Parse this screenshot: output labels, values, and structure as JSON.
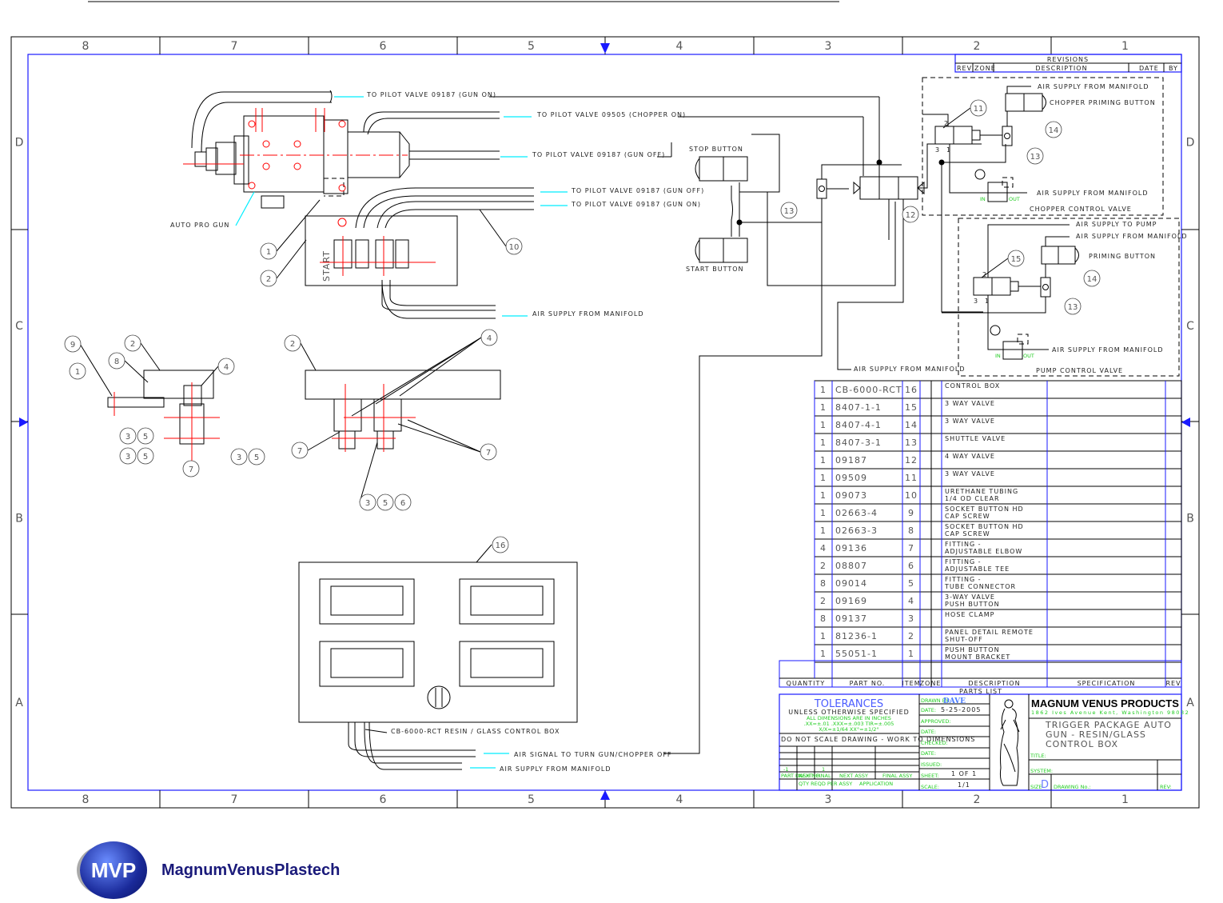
{
  "frame": {
    "zones_top": [
      "8",
      "7",
      "6",
      "5",
      "4",
      "3",
      "2",
      "1"
    ],
    "zones_side": [
      "D",
      "C",
      "B",
      "A"
    ],
    "colors": {
      "border": "#1a1aff",
      "centerline": "#ff0000",
      "leader": "#00e5ff",
      "note": "#22cc22"
    }
  },
  "labels": {
    "gun_on_1": "TO PILOT VALVE 09187 (GUN ON)",
    "chopper_on": "TO PILOT VALVE 09505 (CHOPPER ON)",
    "gun_off_1": "TO PILOT VALVE 09187 (GUN OFF)",
    "gun_off_2": "TO PILOT VALVE 09187 (GUN OFF)",
    "gun_on_2": "TO PILOT VALVE 09187 (GUN ON)",
    "air_supply_1": "AIR SUPPLY FROM MANIFOLD",
    "auto_pro_gun": "AUTO PRO GUN",
    "start_panel": "START",
    "stop_button": "STOP BUTTON",
    "start_button": "START BUTTON",
    "air_supply_center": "AIR SUPPLY FROM MANIFOLD",
    "control_box": "CB-6000-RCT RESIN / GLASS CONTROL BOX",
    "air_signal_off": "AIR SIGNAL TO TURN GUN/CHOPPER OFF",
    "air_supply_box": "AIR SUPPLY FROM MANIFOLD"
  },
  "chopper_group": {
    "air_supply_top": "AIR SUPPLY FROM MANIFOLD",
    "priming_button": "CHOPPER PRIMING BUTTON",
    "air_supply_bottom": "AIR SUPPLY FROM MANIFOLD",
    "title": "CHOPPER CONTROL VALVE",
    "in": "IN",
    "out": "OUT",
    "port_2": "2",
    "port_3": "3",
    "port_1": "1"
  },
  "pump_group": {
    "air_to_pump": "AIR SUPPLY TO PUMP",
    "air_supply_top": "AIR SUPPLY FROM MANIFOLD",
    "priming_button": "PRIMING BUTTON",
    "air_supply_bottom": "AIR SUPPLY FROM MANIFOLD",
    "title": "PUMP CONTROL VALVE",
    "in": "IN",
    "out": "OUT",
    "port_2": "2",
    "port_3": "3",
    "port_1": "1"
  },
  "balloons": [
    "11",
    "14",
    "13",
    "13",
    "12",
    "15",
    "14",
    "13",
    "1",
    "2",
    "10",
    "9",
    "8",
    "1",
    "2",
    "4",
    "3",
    "5",
    "3",
    "5",
    "3",
    "5",
    "7",
    "2",
    "4",
    "7",
    "7",
    "3",
    "5",
    "6",
    "16"
  ],
  "revisions": {
    "title": "REVISIONS",
    "headers": [
      "REV",
      "ZONE",
      "DESCRIPTION",
      "DATE",
      "BY"
    ]
  },
  "parts_list": {
    "title": "PARTS LIST",
    "headers": [
      "QUANTITY",
      "PART NO.",
      "ITEM",
      "ZONE",
      "DESCRIPTION",
      "SPECIFICATION",
      "REV"
    ],
    "rows": [
      {
        "qty": "1",
        "part": "CB-6000-RCT",
        "item": "16",
        "desc": [
          "CONTROL BOX"
        ]
      },
      {
        "qty": "1",
        "part": "8407-1-1",
        "item": "15",
        "desc": [
          "3 WAY VALVE"
        ]
      },
      {
        "qty": "1",
        "part": "8407-4-1",
        "item": "14",
        "desc": [
          "3 WAY VALVE"
        ]
      },
      {
        "qty": "1",
        "part": "8407-3-1",
        "item": "13",
        "desc": [
          "SHUTTLE VALVE"
        ]
      },
      {
        "qty": "1",
        "part": "09187",
        "item": "12",
        "desc": [
          "4 WAY VALVE"
        ]
      },
      {
        "qty": "1",
        "part": "09509",
        "item": "11",
        "desc": [
          "3 WAY VALVE"
        ]
      },
      {
        "qty": "1",
        "part": "09073",
        "item": "10",
        "desc": [
          "URETHANE TUBING",
          "1/4 OD CLEAR"
        ]
      },
      {
        "qty": "1",
        "part": "02663-4",
        "item": "9",
        "desc": [
          "SOCKET BUTTON HD",
          "CAP SCREW"
        ]
      },
      {
        "qty": "1",
        "part": "02663-3",
        "item": "8",
        "desc": [
          "SOCKET BUTTON HD",
          "CAP SCREW"
        ]
      },
      {
        "qty": "4",
        "part": "09136",
        "item": "7",
        "desc": [
          "FITTING -",
          "ADJUSTABLE ELBOW"
        ]
      },
      {
        "qty": "2",
        "part": "08807",
        "item": "6",
        "desc": [
          "FITTING -",
          "ADJUSTABLE TEE"
        ]
      },
      {
        "qty": "8",
        "part": "09014",
        "item": "5",
        "desc": [
          "FITTING -",
          "TUBE CONNECTOR"
        ]
      },
      {
        "qty": "2",
        "part": "09169",
        "item": "4",
        "desc": [
          "3-WAY VALVE",
          "PUSH BUTTON"
        ]
      },
      {
        "qty": "8",
        "part": "09137",
        "item": "3",
        "desc": [
          "HOSE CLAMP"
        ]
      },
      {
        "qty": "1",
        "part": "81236-1",
        "item": "2",
        "desc": [
          "PANEL DETAIL REMOTE",
          "SHUT-OFF"
        ]
      },
      {
        "qty": "1",
        "part": "55051-1",
        "item": "1",
        "desc": [
          "PUSH BUTTON",
          "MOUNT BRACKET"
        ]
      }
    ]
  },
  "title_block": {
    "tolerances": "TOLERANCES",
    "unless": "UNLESS OTHERWISE SPECIFIED",
    "tol_lines": [
      "ALL DIMENSIONS ARE IN INCHES",
      ".XX=±.01   .XXX=±.003   TIR=±.005",
      "X/X=±1/64  XX°=±1/2°"
    ],
    "do_not_scale": "DO NOT SCALE DRAWING - WORK TO DIMENSIONS",
    "dash": "-1",
    "final_qty": "1",
    "part_dash_no": "PART DASH NO.",
    "next": "NEXT",
    "final": "FINAL",
    "next_assy": "NEXT ASSY",
    "final_assy": "FINAL ASSY",
    "qty_reqd": "QTY REQD PER ASSY",
    "application": "APPLICATION",
    "drawn_by_label": "DRAWN BY:",
    "drawn_by": "DAVE",
    "date_label": "DATE:",
    "date": "5-25-2005",
    "approved_label": "APPROVED:",
    "date2_label": "DATE:",
    "checked_label": "CHECKED:",
    "date3_label": "DATE:",
    "issued_label": "ISSUED:",
    "sheet_label": "SHEET:",
    "sheet": "1 OF 1",
    "scale_label": "SCALE:",
    "scale": "1/1",
    "company": "MAGNUM VENUS PRODUCTS",
    "address": "1862 Ives Avenue   Kent, Washington   98032",
    "title_lines": [
      "TRIGGER PACKAGE AUTO",
      "GUN - RESIN/GLASS",
      "CONTROL BOX"
    ],
    "title_label": "TITLE:",
    "system_label": "SYSTEM:",
    "size_label": "SIZE",
    "size": "D",
    "drawing_no_label": "DRAWING No.:",
    "rev_label": "REV:"
  },
  "logo": {
    "mark": "MVP",
    "name": "MagnumVenusPlastech"
  }
}
